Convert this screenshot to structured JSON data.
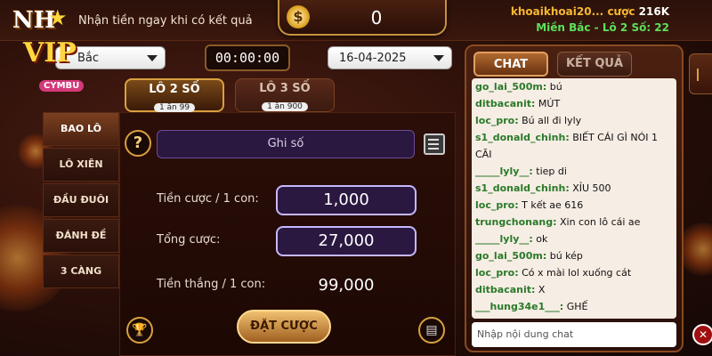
{
  "marquee": "Nhận tiền ngay khi có kết quả",
  "balance": {
    "icon": "dollar-coin-icon",
    "symbol": "$",
    "value": "0"
  },
  "user": {
    "name": "khoaikhoai20...",
    "bet_label": "cược",
    "bet_value": "216K",
    "line2": "Miền Bắc - Lô 2 Số: 22"
  },
  "logo": {
    "line1": "NH",
    "line2": "VIP",
    "badge": "CYMBU"
  },
  "region_select": {
    "value": "Bắc"
  },
  "timer": "00:00:00",
  "date_select": {
    "value": "16-04-2025"
  },
  "menu": [
    "BAO LÔ",
    "LÔ XIÊN",
    "ĐẦU ĐUÔI",
    "ĐÁNH ĐỀ",
    "3 CÀNG"
  ],
  "tabs": [
    {
      "title": "LÔ 2 SỐ",
      "sub": "1 ăn 99"
    },
    {
      "title": "LÔ 3 SỐ",
      "sub": "1 ăn 900"
    }
  ],
  "form": {
    "note_placeholder": "Ghi số",
    "bet_per_label": "Tiền cược / 1 con:",
    "bet_per_value": "1,000",
    "total_label": "Tổng cược:",
    "total_value": "27,000",
    "win_label": "Tiền thắng / 1 con:",
    "win_value": "99,000",
    "submit": "ĐẶT CƯỢC"
  },
  "chat": {
    "tab_chat": "CHAT",
    "tab_result": "KẾT QUẢ",
    "input_placeholder": "Nhập nội dung chat",
    "messages": [
      {
        "user": "go_lai_500m:",
        "text": " bú"
      },
      {
        "user": "ditbacanit:",
        "text": " MÚT"
      },
      {
        "user": "loc_pro:",
        "text": " Bú all đi lyly"
      },
      {
        "user": "s1_donald_chinh:",
        "text": " BIẾT CÁI GÌ NÓI 1 CÃI"
      },
      {
        "user": "_____lyly__:",
        "text": " tiep di"
      },
      {
        "user": "s1_donald_chinh:",
        "text": " XỈU 500"
      },
      {
        "user": "loc_pro:",
        "text": " T kết ae 616"
      },
      {
        "user": "trungchonang:",
        "text": " Xin con lô cái ae"
      },
      {
        "user": "_____lyly__:",
        "text": " ok"
      },
      {
        "user": "go_lai_500m:",
        "text": " bú kép"
      },
      {
        "user": "loc_pro:",
        "text": " Có x mài lol xuống cát"
      },
      {
        "user": "ditbacanit:",
        "text": " X"
      },
      {
        "user": "___hung34e1___:",
        "text": " GHẾ"
      }
    ]
  },
  "colors": {
    "accent_gold": "#d9a040",
    "user_name": "#f7b733",
    "user_line2": "#5ce05c",
    "chat_user": "#2a7a2a"
  }
}
